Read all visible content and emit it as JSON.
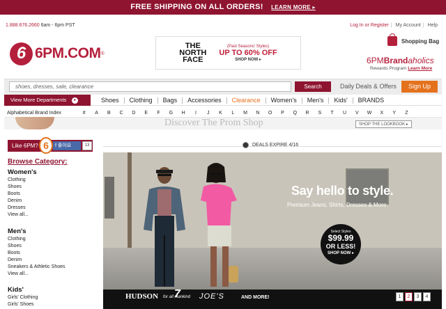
{
  "banner": {
    "text": "FREE SHIPPING ON ALL ORDERS!",
    "learn_more": "LEARN MORE ▸"
  },
  "header": {
    "phone": "1.888.676.2660",
    "hours": "6am - 6pm PST",
    "login": "Log In or Register",
    "account": "My Account",
    "help": "Help",
    "logo_text": "6PM.COM",
    "logo_mark": "6",
    "logo_reg": "®",
    "bag": "Shopping Bag",
    "brandaholics_a": "6PM",
    "brandaholics_b": "Brand",
    "brandaholics_c": "aholics",
    "rewards": "Rewards Program",
    "rewards_link": "Learn More"
  },
  "ad": {
    "brand": "THE NORTH FACE",
    "line1": "(Past Seasons' Styles)",
    "line2": "UP TO 60% OFF",
    "line3": "SHOP NOW ▸"
  },
  "search": {
    "placeholder": "shoes, dresses, sale, clearance",
    "button": "Search",
    "daily": "Daily Deals & Offers",
    "signup": "Sign Up"
  },
  "nav": {
    "view_more": "View More Departments",
    "view_more_icon": "arrow-right-icon",
    "links": [
      "Shoes",
      "Clothing",
      "Bags",
      "Accessories",
      "Clearance",
      "Women's",
      "Men's",
      "Kids'",
      "BRANDS"
    ]
  },
  "alpha": {
    "label": "Alphabetical Brand Index",
    "letters": [
      "#",
      "A",
      "B",
      "C",
      "D",
      "E",
      "F",
      "G",
      "H",
      "I",
      "J",
      "K",
      "L",
      "M",
      "N",
      "O",
      "P",
      "Q",
      "R",
      "S",
      "T",
      "U",
      "V",
      "W",
      "X",
      "Y",
      "Z"
    ]
  },
  "prom": {
    "title": "Discover The Prom Shop",
    "lookbook": "SHOP THE LOOKBOOK ▸"
  },
  "like": {
    "text": "Like 6PM?",
    "mark": "6",
    "fb": "f 좋아요",
    "count": "13"
  },
  "deals": {
    "text": "DEALS EXPIRE 4/16"
  },
  "browse": {
    "title": "Browse Category:",
    "groups": [
      {
        "name": "Women's",
        "items": [
          "Clothing",
          "Shoes",
          "Boots",
          "Denim",
          "Dresses",
          "View all..."
        ]
      },
      {
        "name": "Men's",
        "items": [
          "Clothing",
          "Shoes",
          "Boots",
          "Denim",
          "Sneakers & Athletic Shoes",
          "View all..."
        ]
      },
      {
        "name": "Kids'",
        "items": [
          "Girls' Clothing",
          "Girls' Shoes"
        ]
      }
    ]
  },
  "hero": {
    "headline": "Say hello to style.",
    "sub": "Premium Jeans, Shirts, Dresses & More",
    "badge_a": "Select Styles",
    "badge_b": "$99.99",
    "badge_c": "OR LESS!",
    "badge_d": "SHOP NOW ▸",
    "brands": [
      "HUDSON",
      "for all mankind",
      "JOE'S",
      "AND MORE!"
    ],
    "brand_seven": "7",
    "pages": [
      "1",
      "2",
      "3",
      "4"
    ]
  },
  "colors": {
    "brand": "#8e1430",
    "accent": "#e4711c",
    "link": "#b4203c"
  }
}
